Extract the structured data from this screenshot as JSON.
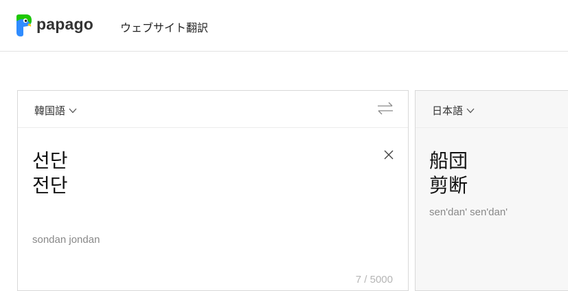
{
  "header": {
    "logo_text": "papago",
    "site_title": "ウェブサイト翻訳"
  },
  "source": {
    "language": "韓国語",
    "text": "선단\n전단",
    "romanization": "sondan jondan",
    "counter": "7 / 5000"
  },
  "target": {
    "language": "日本語",
    "text": "船団\n剪断",
    "romanization": "sen'dan' sen'dan'"
  },
  "icons": {
    "logo": "papago-parrot-icon",
    "swap": "swap-arrows-icon",
    "clear": "close-icon",
    "chevron": "chevron-down-icon"
  },
  "colors": {
    "logo_green": "#1ec800",
    "logo_blue": "#2f8cff",
    "text": "#222222",
    "muted": "#888888"
  }
}
